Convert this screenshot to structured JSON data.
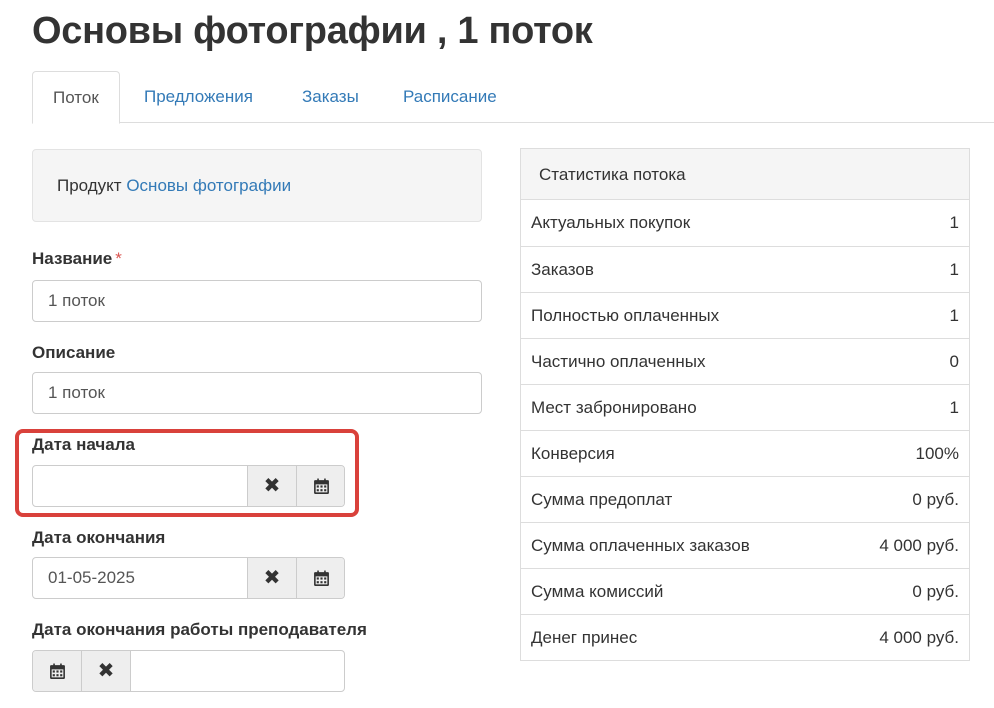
{
  "page": {
    "title": "Основы фотографии , 1 поток"
  },
  "tabs": [
    {
      "label": "Поток",
      "active": true
    },
    {
      "label": "Предложения",
      "active": false
    },
    {
      "label": "Заказы",
      "active": false
    },
    {
      "label": "Расписание",
      "active": false
    }
  ],
  "product": {
    "prefix": "Продукт",
    "link": "Основы фотографии"
  },
  "form": {
    "name_label": "Название",
    "name_required": "*",
    "name_value": "1 поток",
    "description_label": "Описание",
    "description_value": "1 поток",
    "start_date_label": "Дата начала",
    "start_date_value": "",
    "end_date_label": "Дата окончания",
    "end_date_value": "01-05-2025",
    "teacher_end_label": "Дата окончания работы преподавателя",
    "teacher_end_value": ""
  },
  "stats": {
    "heading": "Статистика потока",
    "rows": [
      {
        "label": "Актуальных покупок",
        "value": "1"
      },
      {
        "label": "Заказов",
        "value": "1"
      },
      {
        "label": "Полностью оплаченных",
        "value": "1"
      },
      {
        "label": "Частично оплаченных",
        "value": "0"
      },
      {
        "label": "Мест забронировано",
        "value": "1"
      },
      {
        "label": "Конверсия",
        "value": "100%"
      },
      {
        "label": "Сумма предоплат",
        "value": "0 руб."
      },
      {
        "label": "Сумма оплаченных заказов",
        "value": "4 000 руб."
      },
      {
        "label": "Сумма комиссий",
        "value": "0 руб."
      },
      {
        "label": "Денег принес",
        "value": "4 000 руб."
      }
    ]
  },
  "icons": {
    "clear": "close-icon",
    "calendar": "calendar-icon"
  },
  "colors": {
    "link": "#337ab7",
    "highlight": "#d9413b",
    "required": "#d9534f"
  }
}
